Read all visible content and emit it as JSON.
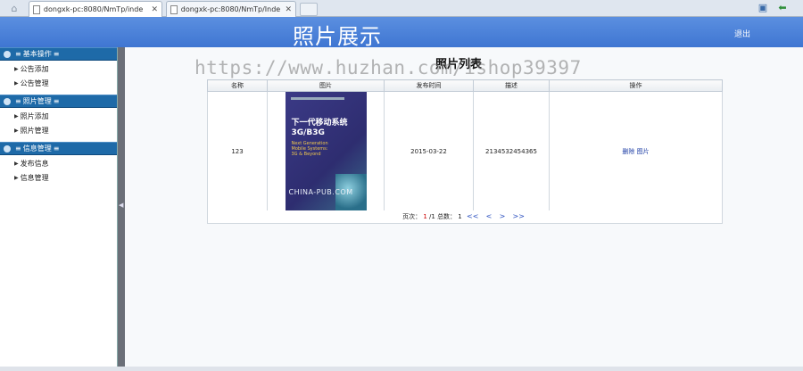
{
  "browser": {
    "tabs": [
      {
        "title": "dongxk-pc:8080/NmTp/inde",
        "active": true
      },
      {
        "title": "dongxk-pc:8080/NmTp/Inde",
        "active": false
      }
    ]
  },
  "header": {
    "site_title": "照片展示",
    "logout_label": "退出"
  },
  "sidebar": {
    "groups": [
      {
        "title": "基本操作",
        "items": [
          "公告添加",
          "公告管理"
        ]
      },
      {
        "title": "照片管理",
        "items": [
          "照片添加",
          "照片管理"
        ]
      },
      {
        "title": "信息管理",
        "items": [
          "发布信息",
          "信息管理"
        ]
      }
    ]
  },
  "main": {
    "page_title": "照片列表",
    "watermark": "https://www.huzhan.com/ishop39397",
    "table": {
      "headers": [
        "名称",
        "图片",
        "发布时间",
        "描述",
        "操作"
      ],
      "rows": [
        {
          "name": "123",
          "image": {
            "main_text_1": "下一代移动系统",
            "main_text_2": "3G/B3G",
            "sub_text_1": "Next Generation",
            "sub_text_2": "Mobile Systems:",
            "sub_text_3": "3G & Beyond",
            "brand": "CHINA-PUB.COM"
          },
          "date": "2015-03-22",
          "description": "2134532454365",
          "delete_label": "删除",
          "image_label": "图片"
        }
      ]
    },
    "pager": {
      "page_label": "页次：",
      "current": "1",
      "total_sep": "/1",
      "total_label": "总数：",
      "total": "1",
      "first": "<<",
      "prev": "<",
      "next": ">",
      "last": ">>"
    }
  },
  "colors": {
    "banner": "#4a82da",
    "sidebar_group": "#1e6aa8",
    "splitter": "#6b6f78"
  }
}
